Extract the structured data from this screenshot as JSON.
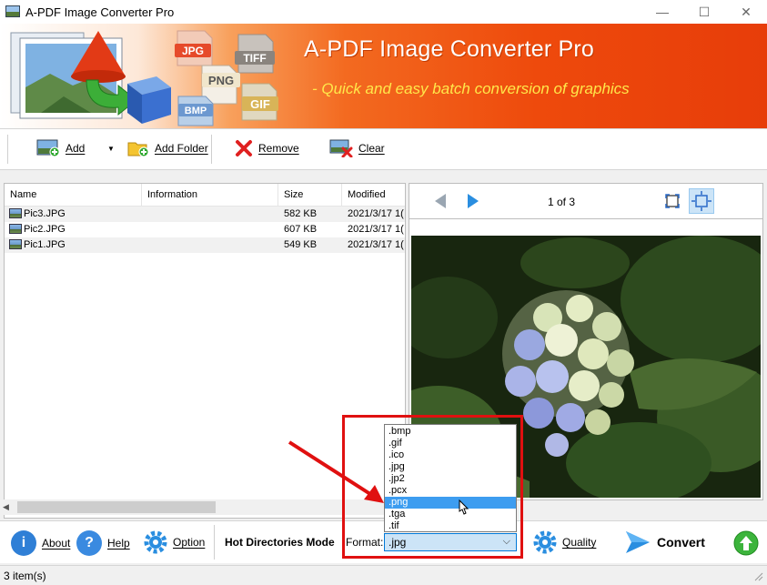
{
  "window": {
    "title": "A-PDF Image Converter Pro",
    "minimize": "—",
    "maximize": "☐",
    "close": "✕"
  },
  "banner": {
    "title": "A-PDF Image Converter Pro",
    "tagline": "- Quick and easy batch conversion of graphics",
    "badges": [
      "JPG",
      "TIFF",
      "PNG",
      "BMP",
      "GIF"
    ]
  },
  "toolbar": {
    "add": "Add",
    "add_folder": "Add Folder",
    "remove": "Remove",
    "clear": "Clear"
  },
  "file_list": {
    "columns": [
      "Name",
      "Information",
      "Size",
      "Modified"
    ],
    "rows": [
      {
        "name": "Pic3.JPG",
        "information": "",
        "size": "582 KB",
        "modified": "2021/3/17 1("
      },
      {
        "name": "Pic2.JPG",
        "information": "",
        "size": "607 KB",
        "modified": "2021/3/17 1("
      },
      {
        "name": "Pic1.JPG",
        "information": "",
        "size": "549 KB",
        "modified": "2021/3/17 1("
      }
    ]
  },
  "preview": {
    "page_indicator": "1 of 3"
  },
  "bottom": {
    "about": "About",
    "help": "Help",
    "option": "Option",
    "hot_directories": "Hot Directories Mode",
    "format_label": "Format:",
    "format_value": ".jpg",
    "format_options": [
      ".bmp",
      ".gif",
      ".ico",
      ".jpg",
      ".jp2",
      ".pcx",
      ".png",
      ".tga",
      ".tif"
    ],
    "highlighted_option": ".png",
    "quality": "Quality",
    "convert": "Convert"
  },
  "status": {
    "items": "3 item(s)"
  },
  "colors": {
    "highlight": "#3d9df0",
    "annotation_red": "#e01010",
    "banner_orange": "#ee4a0c"
  }
}
